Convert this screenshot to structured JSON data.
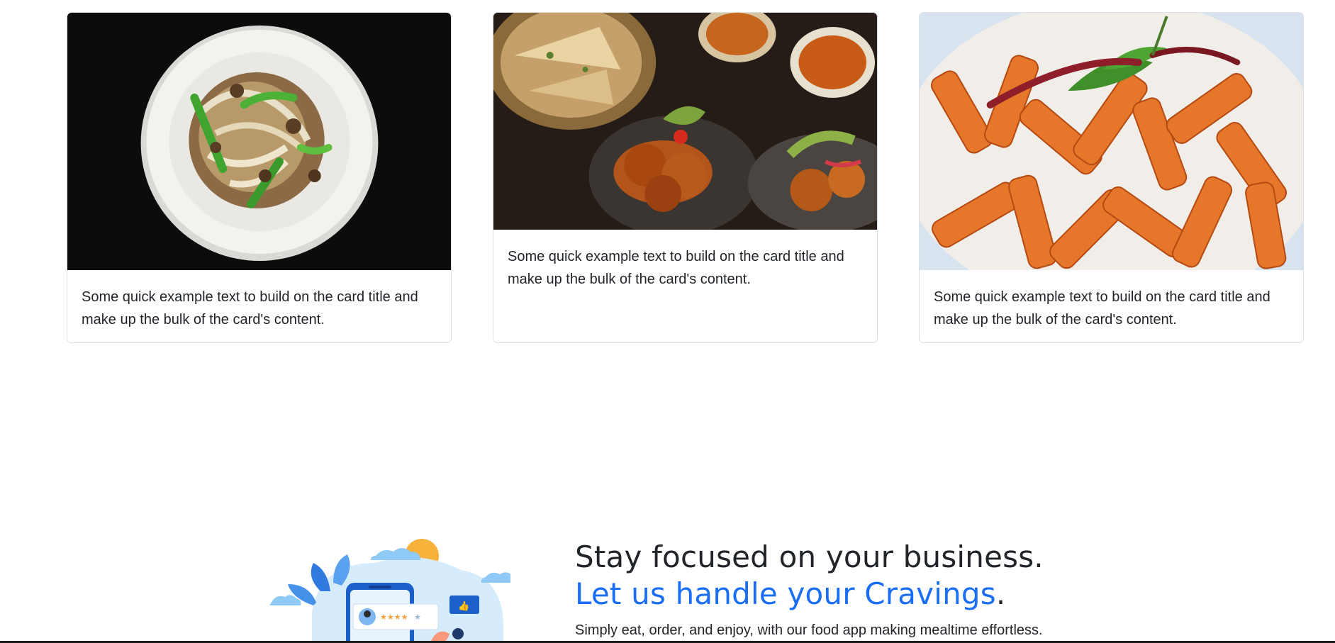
{
  "cards": [
    {
      "image_alt": "Stir-fried noodles with peppers in a white bowl",
      "text": "Some quick example text to build on the card title and make up the bulk of the card's content."
    },
    {
      "image_alt": "Naan, pakoras and curries platter",
      "text": "Some quick example text to build on the card title and make up the bulk of the card's content."
    },
    {
      "image_alt": "Penne pasta in tomato sauce with basil",
      "text": "Some quick example text to build on the card title and make up the bulk of the card's content."
    }
  ],
  "feature": {
    "headline_line1": "Stay focused on your business.",
    "headline_accent": "Let us handle your Cravings",
    "headline_period": ".",
    "subtext": "Simply eat, order, and enjoy, with our food app making mealtime effortless."
  },
  "colors": {
    "accent": "#1a6ef5",
    "text": "#212529",
    "card_border": "#dcdfe3"
  }
}
